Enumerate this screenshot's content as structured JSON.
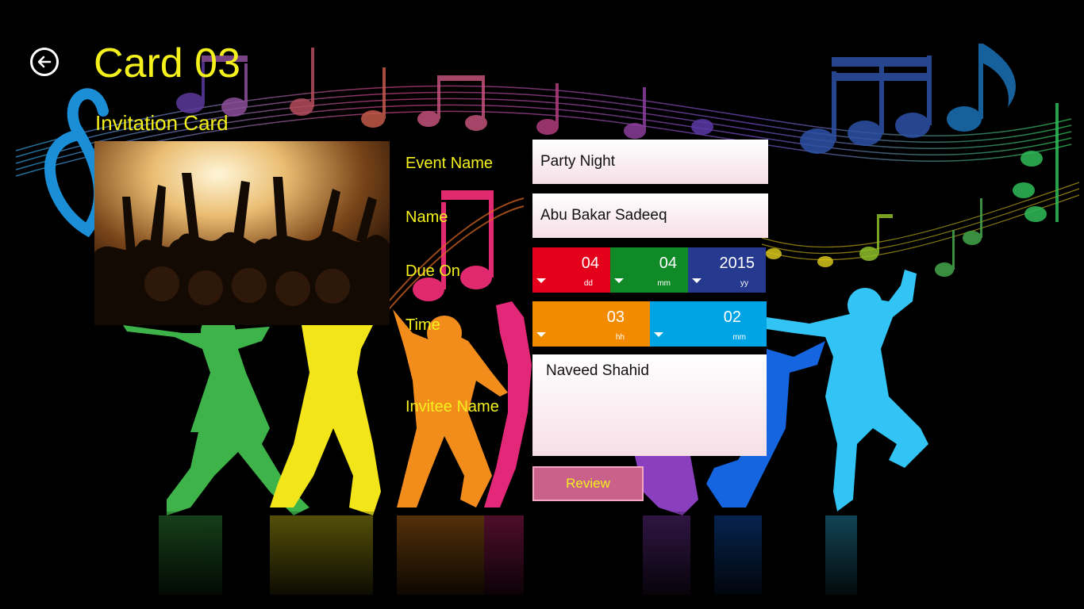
{
  "header": {
    "back_icon": "back-arrow-circle-icon",
    "title": "Card 03",
    "subtitle": "Invitation Card"
  },
  "colors": {
    "title_yellow": "#f4f11c",
    "dd": "#e4001b",
    "mm": "#0f8a27",
    "yy": "#253a8f",
    "hh": "#f38b00",
    "min": "#00a4e4",
    "review_bg": "#c9618a",
    "review_text": "#f4f11c"
  },
  "form": {
    "event_label": "Event Name",
    "event_value": "Party Night",
    "name_label": "Name",
    "name_value": "Abu Bakar Sadeeq",
    "due_label": "Due On",
    "date": {
      "dd": {
        "value": "04",
        "unit": "dd"
      },
      "mm": {
        "value": "04",
        "unit": "mm"
      },
      "yy": {
        "value": "2015",
        "unit": "yy"
      }
    },
    "time_label": "Time",
    "time": {
      "hh": {
        "value": "03",
        "unit": "hh"
      },
      "mm": {
        "value": "02",
        "unit": "mm"
      }
    },
    "invitee_label": "Invitee Name",
    "invitee_value": "Naveed Shahid",
    "review_label": "Review"
  }
}
